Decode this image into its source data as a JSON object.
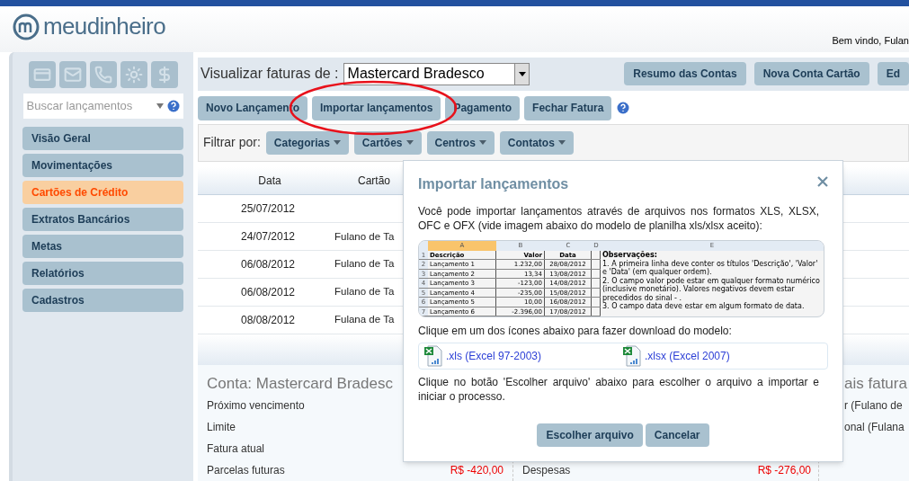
{
  "header": {
    "logo": "meudinheiro",
    "welcome": "Bem vindo, Fulan"
  },
  "sidebar": {
    "search": {
      "placeholder": "Buscar lançamentos"
    },
    "items": [
      {
        "label": "Visão Geral",
        "selected": false
      },
      {
        "label": "Movimentações",
        "selected": false
      },
      {
        "label": "Cartões de Crédito",
        "selected": true
      },
      {
        "label": "Extratos Bancários",
        "selected": false
      },
      {
        "label": "Metas",
        "selected": false
      },
      {
        "label": "Relatórios",
        "selected": false
      },
      {
        "label": "Cadastros",
        "selected": false
      }
    ]
  },
  "toolbar": {
    "label": "Visualizar faturas de :",
    "select_value": "Mastercard Bradesco",
    "buttons": [
      "Resumo das Contas",
      "Nova Conta Cartão",
      "Ed"
    ]
  },
  "actions": [
    "Novo Lançamento",
    "Importar lançamentos",
    "Pagamento",
    "Fechar Fatura"
  ],
  "filter": {
    "label": "Filtrar por:",
    "dropdowns": [
      "Categorias",
      "Cartões",
      "Centros",
      "Contatos"
    ]
  },
  "table": {
    "columns": [
      "Data",
      "Cartão"
    ],
    "rows": [
      {
        "data": "25/07/2012"
      },
      {
        "data": "24/07/2012",
        "cartao": "Fulano de Ta"
      },
      {
        "data": "06/08/2012",
        "cartao": "Fulano de Ta"
      },
      {
        "data": "06/08/2012",
        "cartao": "Fulano de Ta"
      },
      {
        "data": "08/08/2012",
        "cartao": "Fulana de Ta"
      }
    ]
  },
  "summary": {
    "title": "Conta: Mastercard Bradesc",
    "labels": [
      "Próximo vencimento",
      "Limite",
      "Fatura atual",
      "Parcelas futuras"
    ],
    "parcelas_value": "R$ -420,00",
    "despesas_label": "Despesas",
    "despesas_value": "R$ -276,00",
    "side_title": "ais fatura",
    "side_items": [
      "r (Fulano de",
      "onal (Fulana"
    ]
  },
  "dialog": {
    "title": "Importar lançamentos",
    "intro": "Você pode importar lançamentos através de arquivos nos formatos XLS, XLSX, OFC e OFX (vide imagem abaixo do modelo de planilha xls/xlsx aceito):",
    "sheet": {
      "column_letters": [
        "A",
        "B",
        "C",
        "D",
        "E"
      ],
      "rows": [
        {
          "number": "1",
          "cells": [
            "Descrição",
            "Valor",
            "Data"
          ]
        },
        {
          "number": "2",
          "cells": [
            "Lançamento 1",
            "1.232,00",
            "28/08/2012"
          ]
        },
        {
          "number": "3",
          "cells": [
            "Lançamento 2",
            "13,34",
            "13/08/2012"
          ]
        },
        {
          "number": "4",
          "cells": [
            "Lançamento 3",
            "-123,00",
            "14/08/2012"
          ]
        },
        {
          "number": "5",
          "cells": [
            "Lançamento 4",
            "-235,00",
            "15/08/2012"
          ]
        },
        {
          "number": "6",
          "cells": [
            "Lançamento 5",
            "10,00",
            "16/08/2012"
          ]
        },
        {
          "number": "7",
          "cells": [
            "Lançamento 6",
            "-2.396,00",
            "17/08/2012"
          ]
        }
      ],
      "notes_title": "Observações:",
      "notes": [
        "1. A primeira linha deve conter os títulos 'Descrição', 'Valor' e 'Data' (em qualquer ordem).",
        "2. O campo valor pode estar em qualquer formato numérico (inclusive monetário). Valores negativos devem estar precedidos do sinal - .",
        "3. O campo data deve estar em algum formato de data."
      ]
    },
    "download_hint": "Clique em um dos ícones abaixo para fazer download do modelo:",
    "downloads": [
      ".xls (Excel 97-2003)",
      ".xlsx (Excel 2007)"
    ],
    "choose_hint": "Clique no botão 'Escolher arquivo' abaixo para escolher o arquivo a importar e iniciar o processo.",
    "buttons": [
      "Escolher arquivo",
      "Cancelar"
    ]
  }
}
